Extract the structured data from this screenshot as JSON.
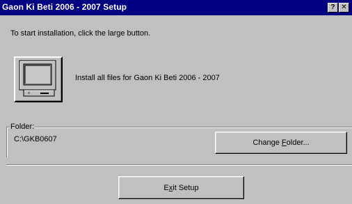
{
  "window": {
    "title": "Gaon Ki Beti 2006 - 2007 Setup",
    "help_label": "?",
    "close_label": "✕"
  },
  "intro_text": "To start installation, click the large button.",
  "install": {
    "icon": "computer-icon",
    "label": "Install all files for Gaon Ki Beti 2006 - 2007"
  },
  "folder": {
    "legend": "Folder:",
    "path": "C:\\GKB0607",
    "change_button": {
      "prefix": "Change ",
      "accel": "F",
      "suffix": "older..."
    }
  },
  "exit_button": {
    "prefix": "E",
    "accel": "x",
    "suffix": "it Setup"
  },
  "colors": {
    "titlebar": "#000080",
    "face": "#c0c0c0"
  }
}
